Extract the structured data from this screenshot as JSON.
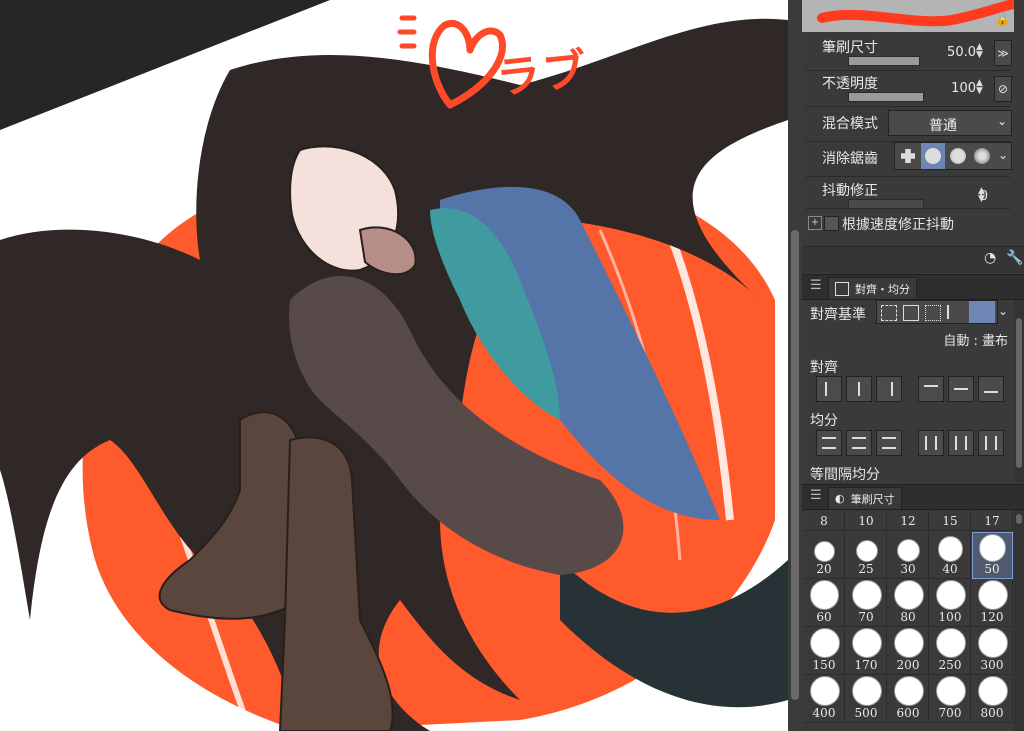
{
  "colors": {
    "accent": "#7f9cd0",
    "panel_bg": "#3a3a3a",
    "canvas_bg": "#262626",
    "hair": "#2f2826",
    "background_red": "#ff5a2c"
  },
  "canvas": {
    "illustration": "anime-character-illustration",
    "annotation_text": "ラブ",
    "annotation_icon": "heart-doodle-icon"
  },
  "tool_props": {
    "brush_size": {
      "label": "筆刷尺寸",
      "value": "50.0",
      "icon": "pressure-icon"
    },
    "opacity": {
      "label": "不透明度",
      "value": "100",
      "icon": "pressure-off-icon"
    },
    "blend_mode": {
      "label": "混合模式",
      "value": "普通"
    },
    "antialias": {
      "label": "消除鋸齒"
    },
    "stabilization": {
      "label": "抖動修正",
      "value": "0"
    },
    "speed_correction": {
      "label": "根據速度修正抖動",
      "checked": false
    }
  },
  "align_panel": {
    "tab": "對齊・均分",
    "basis_label": "對齊基準",
    "auto_label": "自動 : 畫布",
    "align_label": "對齊",
    "distribute_label": "均分",
    "even_label": "等間隔均分"
  },
  "brush_size_panel": {
    "tab": "筆刷尺寸",
    "selected": "50",
    "sizes": [
      "8",
      "10",
      "12",
      "15",
      "17",
      "20",
      "25",
      "30",
      "40",
      "50",
      "60",
      "70",
      "80",
      "100",
      "120",
      "150",
      "170",
      "200",
      "250",
      "300",
      "400",
      "500",
      "600",
      "700",
      "800"
    ]
  }
}
